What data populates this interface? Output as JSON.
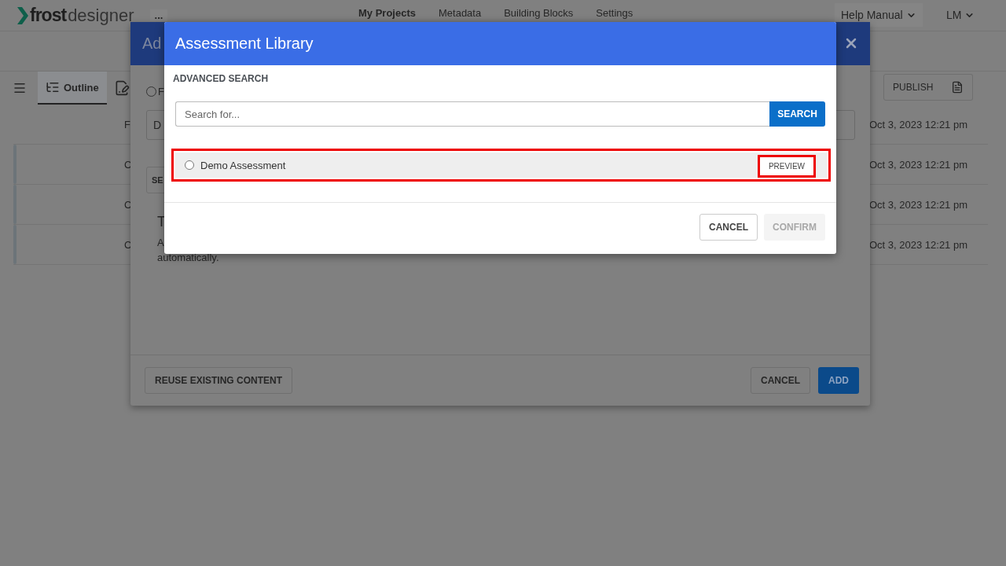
{
  "header": {
    "logo_bold": "frost",
    "logo_light": "designer",
    "more": "...",
    "nav": [
      {
        "label": "My Projects",
        "selected": true
      },
      {
        "label": "Metadata",
        "selected": false
      },
      {
        "label": "Building Blocks",
        "selected": false
      },
      {
        "label": "Settings",
        "selected": false
      }
    ],
    "help": "Help Manual",
    "user": "LM"
  },
  "toolbar": {
    "tabs": [
      {
        "label": "Outline",
        "selected": true
      }
    ],
    "publish": "PUBLISH"
  },
  "rows": [
    {
      "kind": "header",
      "letter": "F",
      "date": "Oct 3, 2023 12:21 pm"
    },
    {
      "kind": "item",
      "letter": "C",
      "date": "Oct 3, 2023 12:21 pm"
    },
    {
      "kind": "item",
      "letter": "C",
      "date": "Oct 3, 2023 12:21 pm"
    },
    {
      "kind": "item",
      "letter": "C",
      "date": "Oct 3, 2023 12:21 pm"
    }
  ],
  "add_dialog": {
    "title": "Ad",
    "option": "F",
    "field_value": "D",
    "button": "SE",
    "heading": "T",
    "text_lines": [
      "A",
      "automatically."
    ],
    "reuse": "REUSE EXISTING CONTENT",
    "cancel": "CANCEL",
    "add": "ADD"
  },
  "library_dialog": {
    "title": "Assessment Library",
    "section": "ADVANCED SEARCH",
    "search_placeholder": "Search for...",
    "search_button": "SEARCH",
    "results": [
      {
        "name": "Demo Assessment",
        "selected": false,
        "highlighted": true,
        "preview": "PREVIEW",
        "preview_highlighted": true
      }
    ],
    "cancel": "CANCEL",
    "confirm": "CONFIRM",
    "confirm_disabled": true
  }
}
